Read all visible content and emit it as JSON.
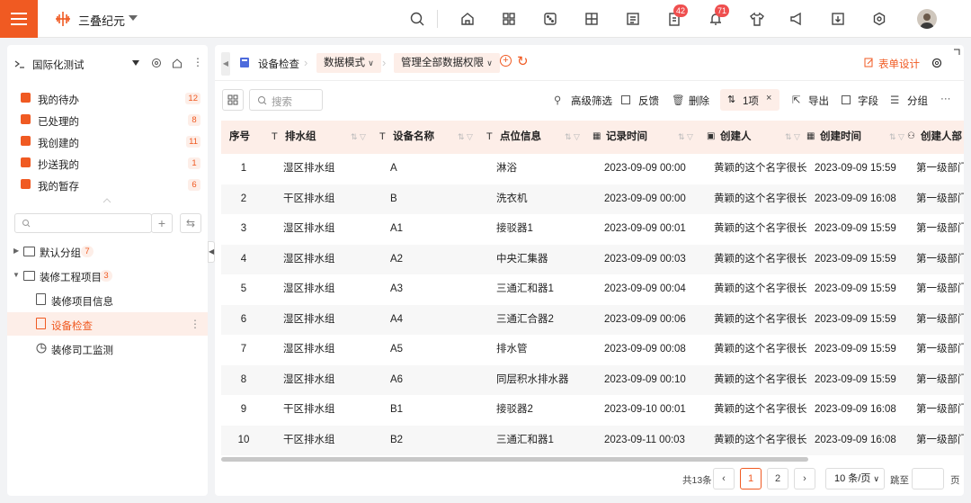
{
  "app": {
    "name": "三叠纪元",
    "accent": "#f05a22"
  },
  "topbar": {
    "badges": {
      "tasks": "42",
      "notifications": "71"
    }
  },
  "sidebar": {
    "title": "国际化测试",
    "quick": [
      {
        "label": "我的待办",
        "count": "12"
      },
      {
        "label": "已处理的",
        "count": "8"
      },
      {
        "label": "我创建的",
        "count": "11"
      },
      {
        "label": "抄送我的",
        "count": "1"
      },
      {
        "label": "我的暂存",
        "count": "6"
      }
    ],
    "tree": [
      {
        "label": "默认分组",
        "count": "7"
      },
      {
        "label": "装修工程项目",
        "count": "3"
      },
      {
        "label": "装修项目信息"
      },
      {
        "label": "设备检查"
      },
      {
        "label": "装修司工监测"
      }
    ]
  },
  "breadcrumb": {
    "page": "设备检查",
    "mode": "数据模式",
    "scope": "管理全部数据权限"
  },
  "header": {
    "form_design": "表单设计"
  },
  "toolbar": {
    "search_placeholder": "搜索",
    "adv_filter": "高级筛选",
    "feedback": "反馈",
    "delete": "删除",
    "sort_chip": "1项",
    "export": "导出",
    "fields": "字段",
    "group": "分组"
  },
  "table": {
    "columns": [
      "序号",
      "排水组",
      "设备名称",
      "点位信息",
      "记录时间",
      "创建人",
      "创建时间",
      "创建人部"
    ],
    "rows": [
      [
        "1",
        "湿区排水组",
        "A",
        "淋浴",
        "2023-09-09 00:00",
        "黄颖的这个名字很长...",
        "2023-09-09 15:59",
        "第一级部门"
      ],
      [
        "2",
        "干区排水组",
        "B",
        "洗衣机",
        "2023-09-09 00:00",
        "黄颖的这个名字很长...",
        "2023-09-09 16:08",
        "第一级部门"
      ],
      [
        "3",
        "湿区排水组",
        "A1",
        "接驳器1",
        "2023-09-09 00:01",
        "黄颖的这个名字很长...",
        "2023-09-09 15:59",
        "第一级部门"
      ],
      [
        "4",
        "湿区排水组",
        "A2",
        "中央汇集器",
        "2023-09-09 00:03",
        "黄颖的这个名字很长...",
        "2023-09-09 15:59",
        "第一级部门"
      ],
      [
        "5",
        "湿区排水组",
        "A3",
        "三通汇和器1",
        "2023-09-09 00:04",
        "黄颖的这个名字很长...",
        "2023-09-09 15:59",
        "第一级部门"
      ],
      [
        "6",
        "湿区排水组",
        "A4",
        "三通汇合器2",
        "2023-09-09 00:06",
        "黄颖的这个名字很长...",
        "2023-09-09 15:59",
        "第一级部门"
      ],
      [
        "7",
        "湿区排水组",
        "A5",
        "排水管",
        "2023-09-09 00:08",
        "黄颖的这个名字很长...",
        "2023-09-09 15:59",
        "第一级部门"
      ],
      [
        "8",
        "湿区排水组",
        "A6",
        "同层积水排水器",
        "2023-09-09 00:10",
        "黄颖的这个名字很长...",
        "2023-09-09 15:59",
        "第一级部门"
      ],
      [
        "9",
        "干区排水组",
        "B1",
        "接驳器2",
        "2023-09-10 00:01",
        "黄颖的这个名字很长...",
        "2023-09-09 16:08",
        "第一级部门"
      ],
      [
        "10",
        "干区排水组",
        "B2",
        "三通汇和器1",
        "2023-09-11 00:03",
        "黄颖的这个名字很长...",
        "2023-09-09 16:08",
        "第一级部门"
      ]
    ]
  },
  "pager": {
    "total": "共13条",
    "pages": [
      "1",
      "2"
    ],
    "current": "1",
    "page_size": "10 条/页",
    "jump": "跳至",
    "page_unit": "页"
  }
}
